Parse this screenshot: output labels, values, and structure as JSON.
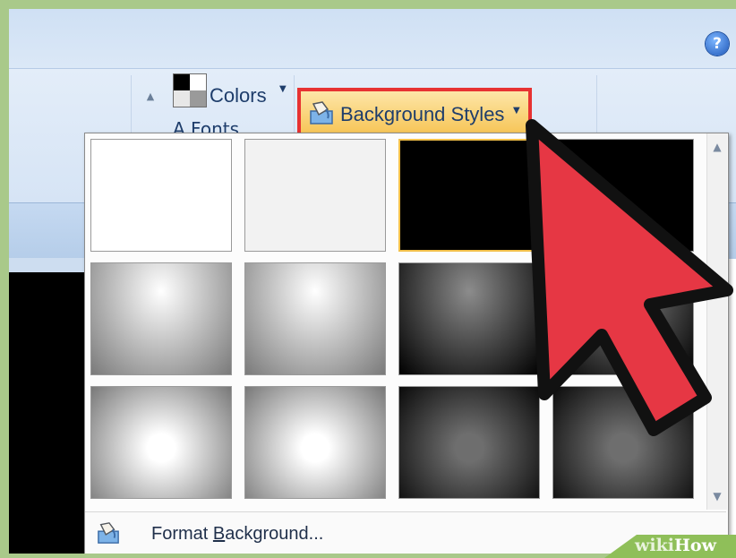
{
  "help": {
    "icon": "help-icon",
    "glyph": "?"
  },
  "ribbon": {
    "scroll_up_glyph": "▲",
    "colors_label": "Colors",
    "colors_arrow": "▼",
    "fonts_label_partial": "A  Fonts",
    "background_styles_label": "Background Styles",
    "background_styles_arrow": "▼"
  },
  "gallery": {
    "thumbnails": [
      {
        "name": "style-1",
        "fill": "#ffffff"
      },
      {
        "name": "style-2",
        "fill": "#f2f2f2"
      },
      {
        "name": "style-3",
        "fill": "#000000",
        "selected": true
      },
      {
        "name": "style-4",
        "fill": "#000000"
      },
      {
        "name": "style-5",
        "fill": "radial-gradient(ellipse at 50% 25%, #ffffff, #7a7a7a)"
      },
      {
        "name": "style-6",
        "fill": "radial-gradient(ellipse at 50% 25%, #ffffff, #7a7a7a)"
      },
      {
        "name": "style-7",
        "fill": "radial-gradient(ellipse at 50% 25%, #8c8c8c, #000000)"
      },
      {
        "name": "style-8",
        "fill": "radial-gradient(ellipse at 50% 25%, #8c8c8c, #000000)"
      },
      {
        "name": "style-9",
        "fill": "radial-gradient(circle at 50% 55%, #ffffff 15%, #787878)"
      },
      {
        "name": "style-10",
        "fill": "radial-gradient(circle at 50% 55%, #ffffff 15%, #787878)"
      },
      {
        "name": "style-11",
        "fill": "radial-gradient(circle at 50% 55%, #6e6e6e 15%, #0a0a0a)"
      },
      {
        "name": "style-12",
        "fill": "radial-gradient(circle at 50% 55%, #6e6e6e 15%, #0a0a0a)"
      }
    ],
    "scroll_up_glyph": "▲",
    "scroll_down_glyph": "▼",
    "format_background_prefix": "Format ",
    "format_background_accel": "B",
    "format_background_suffix": "ackground..."
  },
  "watermark": {
    "part1": "wiki",
    "part2": "How"
  },
  "colors": {
    "highlight_border": "#e73232",
    "cursor_fill": "#e63744",
    "watermark_green": "#8fbf59"
  }
}
